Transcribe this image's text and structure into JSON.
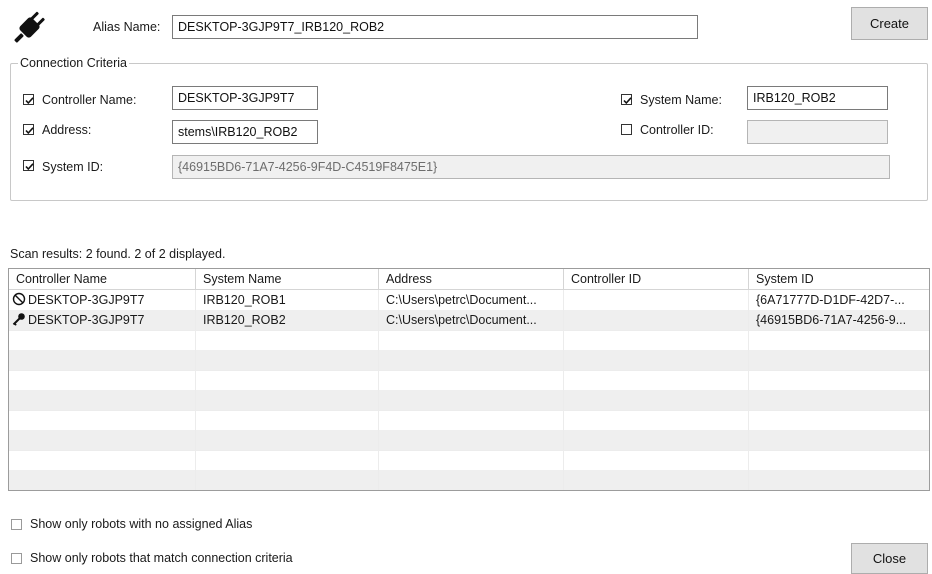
{
  "header": {
    "plug_icon": "plug-icon",
    "alias_label": "Alias Name:",
    "alias_value": "DESKTOP-3GJP9T7_IRB120_ROB2",
    "create_label": "Create"
  },
  "criteria": {
    "legend": "Connection Criteria",
    "controller_name": {
      "label": "Controller Name:",
      "checked": true,
      "value": "DESKTOP-3GJP9T7"
    },
    "address": {
      "label": "Address:",
      "checked": true,
      "value": "stems\\IRB120_ROB2"
    },
    "system_id": {
      "label": "System ID:",
      "checked": true,
      "value": "{46915BD6-71A7-4256-9F4D-C4519F8475E1}"
    },
    "system_name": {
      "label": "System Name:",
      "checked": true,
      "value": "IRB120_ROB2"
    },
    "controller_id": {
      "label": "Controller ID:",
      "checked": false,
      "value": ""
    }
  },
  "results": {
    "summary": "Scan results: 2 found. 2 of 2 displayed.",
    "columns": [
      "Controller Name",
      "System Name",
      "Address",
      "Controller ID",
      "System ID"
    ],
    "rows": [
      {
        "icon": "blocked-icon",
        "cells": [
          "DESKTOP-3GJP9T7",
          "IRB120_ROB1",
          "C:\\Users\\petrc\\Document...",
          "",
          "{6A71777D-D1DF-42D7-..."
        ]
      },
      {
        "icon": "key-icon",
        "cells": [
          "DESKTOP-3GJP9T7",
          "IRB120_ROB2",
          "C:\\Users\\petrc\\Document...",
          "",
          "{46915BD6-71A7-4256-9..."
        ]
      }
    ]
  },
  "filters": {
    "no_alias": {
      "label": "Show only robots with no assigned Alias",
      "checked": false
    },
    "match_criteria": {
      "label": "Show only robots that match connection criteria",
      "checked": false
    }
  },
  "footer": {
    "close_label": "Close"
  }
}
